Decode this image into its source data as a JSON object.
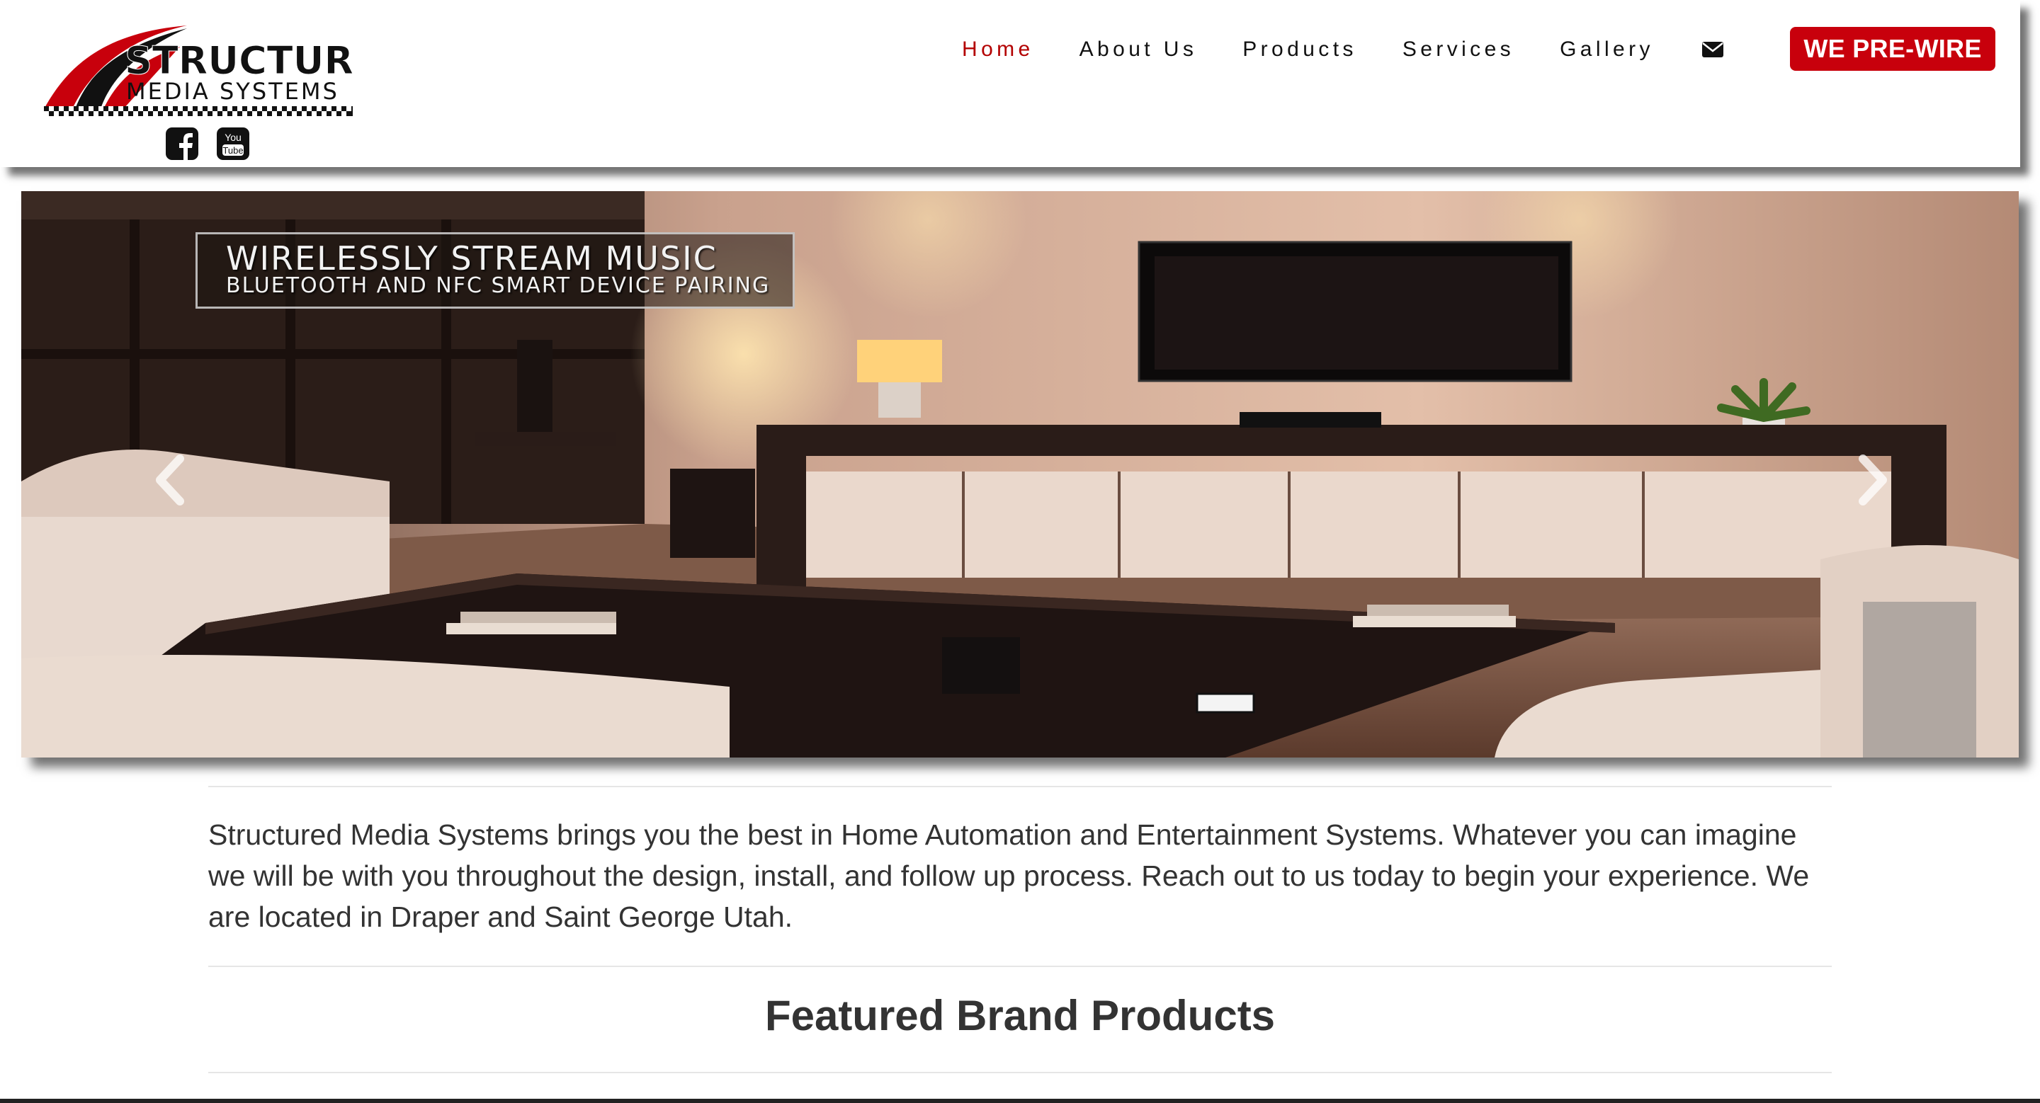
{
  "brand": {
    "logo_line1": "STRUCTURED",
    "logo_line2": "MEDIA SYSTEMS",
    "social": [
      "facebook-icon",
      "youtube-icon"
    ],
    "youtube_glyph_top": "You",
    "youtube_glyph_bottom": "Tube"
  },
  "nav": {
    "items": [
      {
        "label": "Home",
        "active": true
      },
      {
        "label": "About Us",
        "active": false
      },
      {
        "label": "Products",
        "active": false
      },
      {
        "label": "Services",
        "active": false
      },
      {
        "label": "Gallery",
        "active": false
      }
    ],
    "mail_icon": "envelope-icon",
    "cta_label": "WE PRE-WIRE"
  },
  "hero": {
    "caption_title": "WIRELESSLY STREAM MUSIC",
    "caption_subtitle": "BLUETOOTH AND NFC SMART DEVICE PAIRING",
    "prev_icon": "chevron-left-icon",
    "next_icon": "chevron-right-icon"
  },
  "content": {
    "intro": "Structured Media Systems brings you the best in Home Automation and Entertainment Systems. Whatever you can imagine we will be with you throughout the design, install, and follow up process. Reach out to us today to begin your experience. We are located in Draper and Saint George Utah.",
    "featured_heading": "Featured Brand Products"
  },
  "colors": {
    "accent": "#c8000c",
    "active_nav": "#b30000",
    "text": "#333333"
  }
}
